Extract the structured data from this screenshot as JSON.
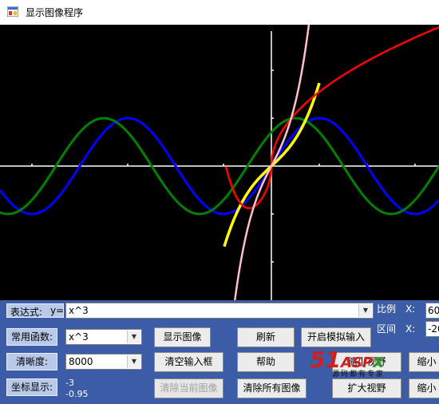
{
  "window": {
    "title": "显示图像程序",
    "icon": "app-window-icon"
  },
  "graph": {
    "background": "#000000",
    "axis_color": "#ffffff",
    "curves": [
      {
        "name": "sin",
        "color": "#0000ff"
      },
      {
        "name": "cos",
        "color": "#008000"
      },
      {
        "name": "x^3",
        "color": "#ffc0cb"
      },
      {
        "name": "log-like",
        "color": "#ff0000"
      },
      {
        "name": "highlight",
        "color": "#ffff00"
      }
    ]
  },
  "controls": {
    "expr_label": "表达式:",
    "expr_y": "y=",
    "expr_value": "x^3",
    "common_label": "常用函数:",
    "common_value": "x^3",
    "clarity_label": "清晰度:",
    "clarity_value": "8000",
    "coord_label": "坐标显示:",
    "coord_x": "-3",
    "coord_y": "-0.95"
  },
  "buttons": {
    "show": "显示图像",
    "refresh": "刷新",
    "simulate": "开启模拟输入",
    "clear_input": "清空输入框",
    "help": "帮助",
    "shrink_view": "缩小视野",
    "clear_current": "清除当前图像",
    "clear_all": "清除所有图像",
    "enlarge_view": "扩大视野",
    "zoom_out_1": "缩小",
    "zoom_out_2": "缩小"
  },
  "right_panel": {
    "ratio_label": "比例",
    "ratio_axis": "X:",
    "ratio_value": "60",
    "range_label": "区间",
    "range_axis": "X:",
    "range_value": "-20"
  },
  "watermark": {
    "brand_num": "51",
    "brand_asp": "ASP",
    "brand_x": "X",
    "slogan": "源码都有专家"
  }
}
